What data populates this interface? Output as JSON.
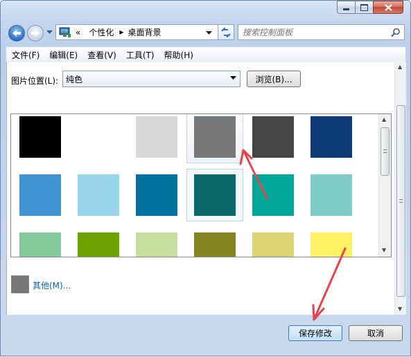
{
  "address_bar": {
    "overflow": "«",
    "crumbs": [
      "个性化",
      "桌面背景"
    ]
  },
  "search": {
    "placeholder": "搜索控制面板"
  },
  "menu": {
    "items": [
      "文件(F)",
      "编辑(E)",
      "查看(V)",
      "工具(T)",
      "帮助(H)"
    ]
  },
  "picture_location": {
    "label": "图片位置(L):",
    "value": "纯色",
    "browse_label": "浏览(B)..."
  },
  "swatches": [
    {
      "color": "#000000"
    },
    {
      "color": "#ffffff"
    },
    {
      "color": "#d9d9d9"
    },
    {
      "color": "#777777",
      "selected": true
    },
    {
      "color": "#454545"
    },
    {
      "color": "#0e3a78"
    },
    {
      "color": "#4193d2"
    },
    {
      "color": "#99d6ec"
    },
    {
      "color": "#00729f"
    },
    {
      "color": "#0d6a6a",
      "hovered": true
    },
    {
      "color": "#00a89a"
    },
    {
      "color": "#7ecdc7"
    },
    {
      "color": "#83c99b"
    },
    {
      "color": "#6ea102"
    },
    {
      "color": "#c6dfa0"
    },
    {
      "color": "#848520"
    },
    {
      "color": "#dbd573"
    },
    {
      "color": "#fff164"
    }
  ],
  "other": {
    "label": "其他(M)...",
    "color": "#777777"
  },
  "buttons": {
    "save": "保存修改",
    "cancel": "取消"
  },
  "annotation_color": "#e8424a"
}
